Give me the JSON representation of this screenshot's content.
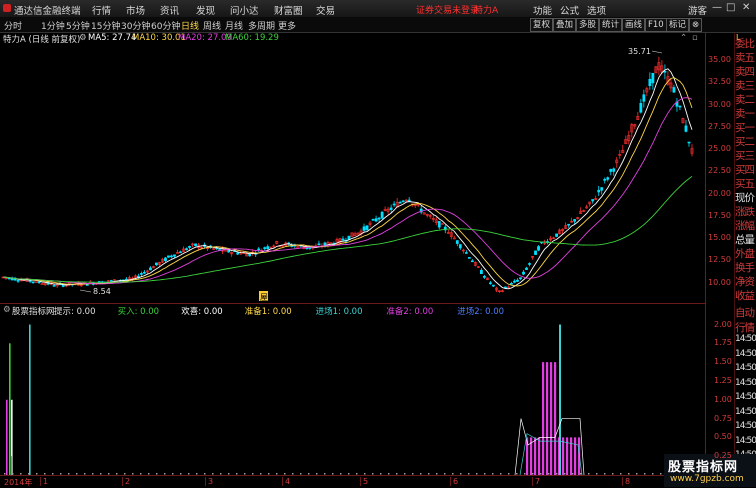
{
  "app": {
    "title": "通达信金融终端",
    "menu": [
      "行情",
      "市场",
      "资讯",
      "发现",
      "问小达",
      "财富圈",
      "交易"
    ],
    "warning": "证券交易未登录",
    "stock_name": "特力A",
    "right_menu": [
      "功能",
      "公式",
      "选项"
    ],
    "user": "游客",
    "win_controls": [
      "—",
      "□",
      "✕"
    ]
  },
  "toolbar": {
    "periods": [
      "分时",
      "1分钟",
      "5分钟",
      "15分钟",
      "30分钟",
      "60分钟",
      "日线",
      "周线",
      "月线",
      "多周期",
      "更多"
    ],
    "active_period": "日线",
    "right_tools": [
      "复权",
      "叠加",
      "多股",
      "统计",
      "画线",
      "F10",
      "标记",
      "⊗"
    ]
  },
  "main_chart": {
    "header_title": "特力A (日线 前复权)",
    "ma": [
      {
        "label": "MA5: 27.74",
        "color": "#ffffff"
      },
      {
        "label": "MA10: 30.01",
        "color": "#ffd84a"
      },
      {
        "label": "MA20: 27.09",
        "color": "#e040e0"
      },
      {
        "label": "MA60: 19.29",
        "color": "#3cd23c"
      }
    ],
    "high_label": "35.71",
    "low_label": "8.54",
    "price_ticks": [
      "35.00",
      "32.50",
      "30.00",
      "27.50",
      "25.00",
      "22.50",
      "20.00",
      "17.50",
      "15.00",
      "12.50",
      "10.00"
    ],
    "event_marker": "屋"
  },
  "indicator": {
    "header_items": [
      {
        "text": "股票指标网",
        "color": "#e0e0e0"
      },
      {
        "text": "提示: 0.00",
        "color": "#e0e0e0"
      },
      {
        "text": "买入: 0.00",
        "color": "#3cd23c"
      },
      {
        "text": "欢喜: 0.00",
        "color": "#ffffff"
      },
      {
        "text": "准备1: 0.00",
        "color": "#ffd84a"
      },
      {
        "text": "进场1: 0.00",
        "color": "#3cd2d2"
      },
      {
        "text": "准备2: 0.00",
        "color": "#e040e0"
      },
      {
        "text": "进场2: 0.00",
        "color": "#4a7dff"
      }
    ],
    "ticks": [
      "2.00",
      "1.75",
      "1.50",
      "1.25",
      "1.00",
      "0.75",
      "0.50",
      "0.25"
    ]
  },
  "side_panel": {
    "top_items": [
      "委比",
      "卖五",
      "卖四",
      "卖三",
      "卖二",
      "卖一",
      "买一",
      "买二",
      "买三",
      "买四",
      "买五",
      "现价",
      "涨跌",
      "涨幅",
      "总量",
      "外盘",
      "换手",
      "净资",
      "收益"
    ],
    "bottom_items": [
      "自动",
      "行情",
      "14:50",
      "14:50",
      "14:50",
      "14:50",
      "14:50",
      "14:50",
      "14:50",
      "14:50",
      "14:50"
    ]
  },
  "bottom_axis": {
    "labels": [
      "2014年",
      "1",
      "2",
      "3",
      "4",
      "5",
      "6",
      "7",
      "8"
    ]
  },
  "watermark": {
    "title": "股票指标网",
    "url": "www.7gpzb.com"
  },
  "colors": {
    "up": "#ff3030",
    "down": "#00e0ff",
    "axis": "#d23b3b"
  }
}
